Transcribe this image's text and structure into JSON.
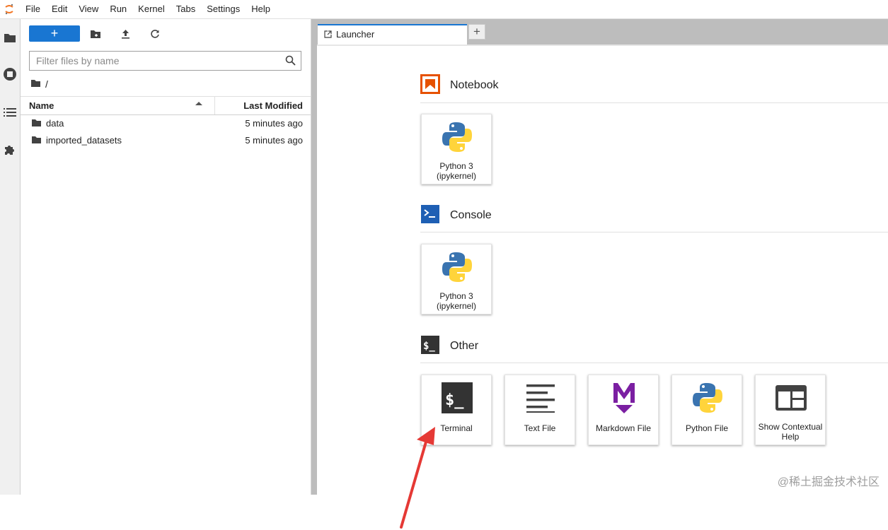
{
  "menu": [
    "File",
    "Edit",
    "View",
    "Run",
    "Kernel",
    "Tabs",
    "Settings",
    "Help"
  ],
  "filebrowser": {
    "new_label": "+",
    "filter_placeholder": "Filter files by name",
    "breadcrumb": "/",
    "columns": {
      "name": "Name",
      "modified": "Last Modified"
    },
    "files": [
      {
        "name": "data",
        "modified": "5 minutes ago"
      },
      {
        "name": "imported_datasets",
        "modified": "5 minutes ago"
      }
    ]
  },
  "tabs": {
    "active": "Launcher",
    "add": "+"
  },
  "launcher": {
    "sections": {
      "notebook": {
        "label": "Notebook",
        "cards": [
          {
            "label": "Python 3 (ipykernel)"
          }
        ]
      },
      "console": {
        "label": "Console",
        "cards": [
          {
            "label": "Python 3 (ipykernel)"
          }
        ]
      },
      "other": {
        "label": "Other",
        "cards": [
          {
            "label": "Terminal",
            "icon": "terminal-icon"
          },
          {
            "label": "Text File",
            "icon": "text-file-icon"
          },
          {
            "label": "Markdown File",
            "icon": "markdown-icon"
          },
          {
            "label": "Python File",
            "icon": "python-icon"
          },
          {
            "label": "Show Contextual Help",
            "icon": "contextual-help-icon"
          }
        ]
      }
    }
  },
  "watermark": "@稀土掘金技术社区",
  "colors": {
    "accent": "#1976d2",
    "notebook": "#e65100",
    "console": "#1e5fb4",
    "markdown": "#7b1fa2",
    "annotation_arrow": "#e53935"
  }
}
